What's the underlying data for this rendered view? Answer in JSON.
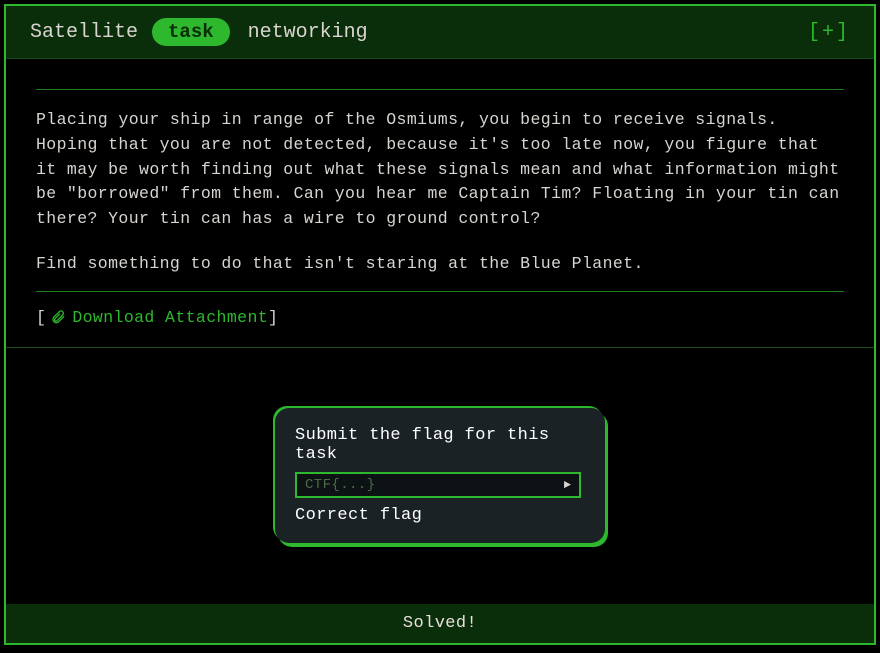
{
  "header": {
    "title": "Satellite",
    "badge": "task",
    "category": "networking",
    "expand": "[+]"
  },
  "body": {
    "description": "Placing your ship in range of the Osmiums, you begin to receive signals. Hoping that you are not detected, because it's too late now, you figure that it may be worth finding out what these signals mean and what information might be \"borrowed\" from them. Can you hear me Captain Tim? Floating in your tin can there? Your tin can has a wire to ground control?",
    "hint": "Find something to do that isn't staring at the Blue Planet.",
    "download_label": "Download Attachment"
  },
  "submit": {
    "label": "Submit the flag for this task",
    "placeholder": "CTF{...}",
    "status": "Correct flag"
  },
  "footer": {
    "solved": "Solved!"
  }
}
